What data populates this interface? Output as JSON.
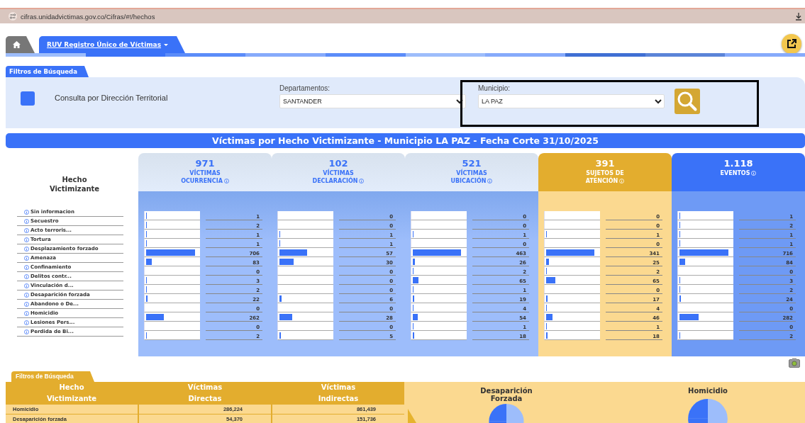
{
  "browser": {
    "url": "cifras.unidadvictimas.gov.co/Cifras/#!/hechos"
  },
  "nav": {
    "tabs": [
      {
        "kind": "home",
        "selected": false
      },
      {
        "kind": "menu",
        "label": "RUV Registro Único de Víctimas",
        "selected": true
      }
    ]
  },
  "filters": {
    "tab": "Filtros de Búsqueda",
    "territorial": {
      "label": "Consulta por Dirección Territorial",
      "checked": false
    },
    "departamento": {
      "label": "Departamentos:",
      "value": "SANTANDER"
    },
    "municipio": {
      "label": "Municipio:",
      "value": "LA PAZ",
      "highlighted": true
    }
  },
  "title": "Víctimas por Hecho Victimizante - Municipio LA PAZ - Fecha Corte 31/10/2025",
  "table": {
    "row_header": "Hecho Victimizante",
    "rows": [
      "Sin informacion",
      "Secuestro",
      "Acto terroris...",
      "Tortura",
      "Desplazamiento forzado",
      "Amenaza",
      "Confinamiento",
      "Delitos contr...",
      "Vinculación d...",
      "Desaparición forzada",
      "Abandono o De...",
      "Homicidio",
      "Lesiones Pers...",
      "Perdida de Bi..."
    ],
    "columns": [
      {
        "kind": "victims",
        "total": "971",
        "label": [
          "VÍCTIMAS",
          "OCURRENCIA"
        ],
        "cells": [
          {
            "value": "1",
            "level": 0.005
          },
          {
            "value": "2",
            "level": 0.005
          },
          {
            "value": "1",
            "level": 0.005
          },
          {
            "value": "1",
            "level": 0.005
          },
          {
            "value": "706",
            "level": 0.91
          },
          {
            "value": "83",
            "level": 0.1
          },
          {
            "value": "0",
            "level": 0
          },
          {
            "value": "3",
            "level": 0.005
          },
          {
            "value": "2",
            "level": 0.005
          },
          {
            "value": "22",
            "level": 0.03
          },
          {
            "value": "0",
            "level": 0
          },
          {
            "value": "262",
            "level": 0.33
          },
          {
            "value": "0",
            "level": 0
          },
          {
            "value": "2",
            "level": 0.005
          }
        ]
      },
      {
        "kind": "victims",
        "total": "102",
        "label": [
          "VÍCTIMAS",
          "DECLARACIÓN"
        ],
        "cells": [
          {
            "value": "0",
            "level": 0
          },
          {
            "value": "0",
            "level": 0
          },
          {
            "value": "1",
            "level": 0.01
          },
          {
            "value": "1",
            "level": 0.01
          },
          {
            "value": "57",
            "level": 0.51
          },
          {
            "value": "30",
            "level": 0.26
          },
          {
            "value": "0",
            "level": 0
          },
          {
            "value": "0",
            "level": 0
          },
          {
            "value": "0",
            "level": 0
          },
          {
            "value": "6",
            "level": 0.04
          },
          {
            "value": "0",
            "level": 0
          },
          {
            "value": "28",
            "level": 0.24
          },
          {
            "value": "0",
            "level": 0
          },
          {
            "value": "5",
            "level": 0.03
          }
        ]
      },
      {
        "kind": "victims",
        "total": "521",
        "label": [
          "VÍCTIMAS",
          "UBICACIÓN"
        ],
        "cells": [
          {
            "value": "0",
            "level": 0
          },
          {
            "value": "0",
            "level": 0
          },
          {
            "value": "1",
            "level": 0.005
          },
          {
            "value": "0",
            "level": 0
          },
          {
            "value": "463",
            "level": 0.9
          },
          {
            "value": "26",
            "level": 0.04
          },
          {
            "value": "2",
            "level": 0.005
          },
          {
            "value": "65",
            "level": 0.11
          },
          {
            "value": "1",
            "level": 0.005
          },
          {
            "value": "19",
            "level": 0.03
          },
          {
            "value": "4",
            "level": 0.005
          },
          {
            "value": "54",
            "level": 0.09
          },
          {
            "value": "1",
            "level": 0.005
          },
          {
            "value": "18",
            "level": 0.02
          }
        ]
      },
      {
        "kind": "subjects",
        "total": "391",
        "label": [
          "SUJETOS DE",
          "ATENCIÓN"
        ],
        "cells": [
          {
            "value": "0",
            "level": 0
          },
          {
            "value": "0",
            "level": 0
          },
          {
            "value": "1",
            "level": 0.005
          },
          {
            "value": "0",
            "level": 0
          },
          {
            "value": "341",
            "level": 0.9
          },
          {
            "value": "25",
            "level": 0.05
          },
          {
            "value": "2",
            "level": 0.005
          },
          {
            "value": "65",
            "level": 0.17
          },
          {
            "value": "0",
            "level": 0
          },
          {
            "value": "17",
            "level": 0.02
          },
          {
            "value": "4",
            "level": 0.005
          },
          {
            "value": "46",
            "level": 0.12
          },
          {
            "value": "1",
            "level": 0.005
          },
          {
            "value": "18",
            "level": 0.03
          }
        ]
      },
      {
        "kind": "events",
        "total": "1.118",
        "label": [
          "EVENTOS"
        ],
        "cells": [
          {
            "value": "1",
            "level": 0.005
          },
          {
            "value": "2",
            "level": 0.005
          },
          {
            "value": "1",
            "level": 0.005
          },
          {
            "value": "1",
            "level": 0.005
          },
          {
            "value": "716",
            "level": 0.91
          },
          {
            "value": "84",
            "level": 0.1
          },
          {
            "value": "0",
            "level": 0
          },
          {
            "value": "3",
            "level": 0.005
          },
          {
            "value": "2",
            "level": 0.005
          },
          {
            "value": "24",
            "level": 0.03
          },
          {
            "value": "0",
            "level": 0
          },
          {
            "value": "282",
            "level": 0.35
          },
          {
            "value": "0",
            "level": 0
          },
          {
            "value": "2",
            "level": 0.005
          }
        ]
      }
    ]
  },
  "summary": {
    "tab": "Filtros de Búsqueda",
    "columns": [
      "Hecho Victimizante",
      "Víctimas Directas",
      "Víctimas Indirectas"
    ],
    "rows": [
      [
        "Homicidio",
        "286,224",
        "861,439"
      ],
      [
        "Desaparición forzada",
        "54,370",
        "151,736"
      ]
    ]
  },
  "pies": [
    {
      "title": "Desaparición Forzada"
    },
    {
      "title": "Homicidio"
    }
  ]
}
